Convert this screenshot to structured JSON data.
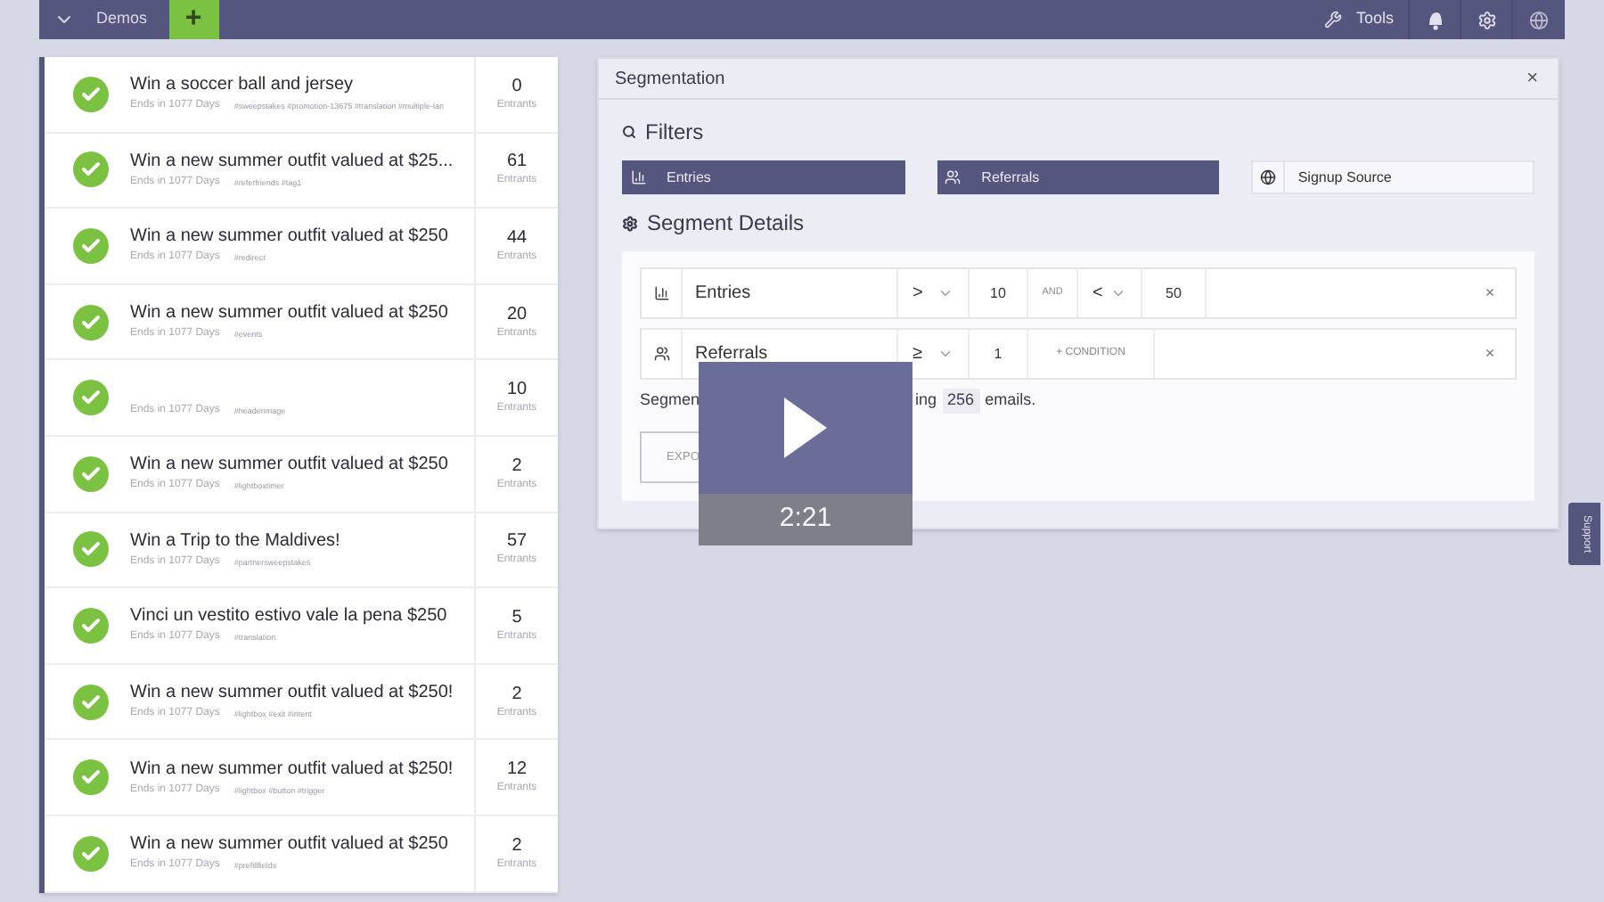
{
  "top_bar": {
    "menu": "Demos",
    "add_button": "+",
    "tools": "Tools"
  },
  "promotions": [
    {
      "title": "Win a soccer ball and jersey",
      "ends": "Ends in 1077 Days",
      "tags": "#sweepstakes #promotion-13675 #translation #multiple-lan",
      "count": "0",
      "count_label": "Entrants",
      "active": true
    },
    {
      "title": "Win a new summer outfit valued at $25...",
      "ends": "Ends in 1077 Days",
      "tags": "#referfriends #tag1",
      "count": "61",
      "count_label": "Entrants",
      "active": true
    },
    {
      "title": "Win a new summer outfit valued at $250",
      "ends": "Ends in 1077 Days",
      "tags": "#redirect",
      "count": "44",
      "count_label": "Entrants",
      "active": true
    },
    {
      "title": "Win a new summer outfit valued at $250",
      "ends": "Ends in 1077 Days",
      "tags": "#events",
      "count": "20",
      "count_label": "Entrants",
      "active": true
    },
    {
      "ends": "Ends in 1077 Days",
      "tags": "#headerimage",
      "count": "10",
      "count_label": "Entrants",
      "active": true
    },
    {
      "title": "Win a new summer outfit valued at $250",
      "ends": "Ends in 1077 Days",
      "tags": "#lightboxtimer",
      "count": "2",
      "count_label": "Entrants",
      "active": true
    },
    {
      "title": "Win a Trip to the Maldives!",
      "ends": "Ends in 1077 Days",
      "tags": "#partnersweepstakes",
      "count": "57",
      "count_label": "Entrants",
      "active": true
    },
    {
      "title": "Vinci un vestito estivo vale la pena $250",
      "ends": "Ends in 1077 Days",
      "tags": "#translation",
      "count": "5",
      "count_label": "Entrants",
      "active": true
    },
    {
      "title": "Win a new summer outfit valued at $250!",
      "ends": "Ends in 1077 Days",
      "tags": "#lightbox #exit #intent",
      "count": "2",
      "count_label": "Entrants",
      "active": true
    },
    {
      "title": "Win a new summer outfit valued at $250!",
      "ends": "Ends in 1077 Days",
      "tags": "#lightbox #button #trigger",
      "count": "12",
      "count_label": "Entrants",
      "active": true
    },
    {
      "title": "Win a new summer outfit valued at $250",
      "ends": "Ends in 1077 Days",
      "tags": "#prefillfields",
      "count": "2",
      "count_label": "Entrants",
      "active": true
    }
  ],
  "segmentation": {
    "title": "Segmentation",
    "close": "×",
    "filters_heading": "Filters",
    "filters": [
      {
        "label": "Entries",
        "selected": true
      },
      {
        "label": "Referrals",
        "selected": true
      },
      {
        "label": "Signup Source",
        "selected": false
      }
    ],
    "details_heading": "Segment Details",
    "conditions": [
      {
        "kind": "range",
        "field": "Entries",
        "op1": ">",
        "value1": "10",
        "joiner": "AND",
        "op2": "<",
        "value2": "50",
        "remove": "×"
      },
      {
        "kind": "single",
        "field": "Referrals",
        "op1": "≥",
        "value1": "1",
        "add": "+ CONDITION",
        "remove": "×"
      }
    ],
    "summary": {
      "prefix": "Segmen",
      "tail": "ing",
      "count": "256",
      "suffix": "emails."
    },
    "export_button": "EXPO"
  },
  "video": {
    "duration": "2:21"
  },
  "support_tab": "Support"
}
